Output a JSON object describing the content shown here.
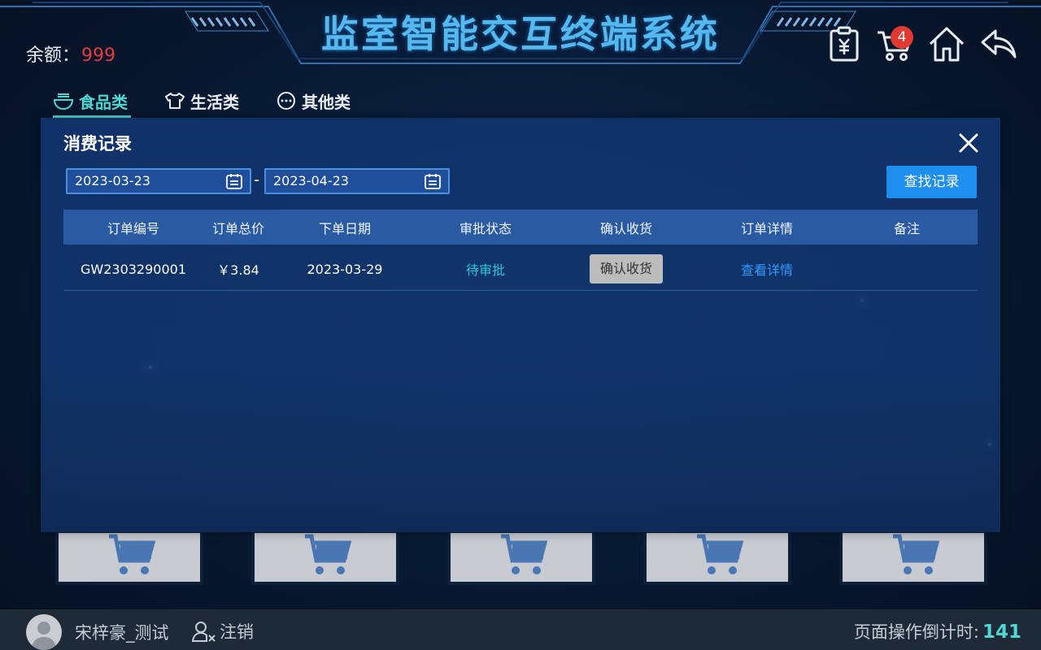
{
  "header": {
    "title": "监室智能交互终端系统",
    "balance_label": "余额：",
    "balance_value": "999",
    "cart_count": "4",
    "icons": [
      "receipt-icon",
      "cart-icon",
      "home-icon",
      "back-icon"
    ]
  },
  "tabs": [
    {
      "label": "食品类",
      "icon": "bowl-icon",
      "active": true
    },
    {
      "label": "生活类",
      "icon": "shirt-icon",
      "active": false
    },
    {
      "label": "其他类",
      "icon": "more-icon",
      "active": false
    }
  ],
  "modal": {
    "title": "消费记录",
    "date_from": "2023-03-23",
    "date_separator": "-",
    "date_to": "2023-04-23",
    "search_label": "查找记录",
    "columns": [
      "订单编号",
      "订单总价",
      "下单日期",
      "审批状态",
      "确认收货",
      "订单详情",
      "备注"
    ],
    "rows": [
      {
        "order_no": "GW2303290001",
        "total": "￥3.84",
        "date": "2023-03-29",
        "status": "待审批",
        "confirm_label": "确认收货",
        "detail_label": "查看详情",
        "remark": ""
      }
    ]
  },
  "footer": {
    "user_name": "宋梓豪_测试",
    "logout_label": "注销",
    "countdown_label": "页面操作倒计时:",
    "countdown_value": "141"
  },
  "colors": {
    "accent_teal": "#4fd7d0",
    "balance_red": "#e03d3d",
    "primary_blue": "#1e8ff0",
    "status_cyan": "#27c9dd",
    "badge_red": "#e23a32"
  }
}
